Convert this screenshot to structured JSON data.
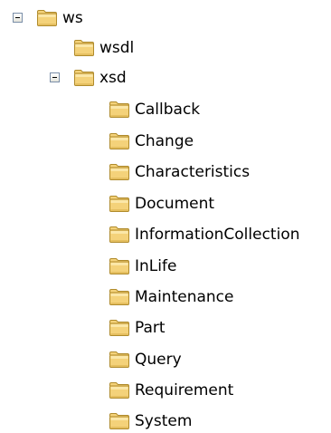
{
  "tree": {
    "root": {
      "label": "ws",
      "expanded": true,
      "children": [
        {
          "label": "wsdl"
        },
        {
          "label": "xsd",
          "expanded": true,
          "children": [
            {
              "label": "Callback"
            },
            {
              "label": "Change"
            },
            {
              "label": "Characteristics"
            },
            {
              "label": "Document"
            },
            {
              "label": "InformationCollection"
            },
            {
              "label": "InLife"
            },
            {
              "label": "Maintenance"
            },
            {
              "label": "Part"
            },
            {
              "label": "Query"
            },
            {
              "label": "Requirement"
            },
            {
              "label": "System"
            }
          ]
        }
      ]
    }
  },
  "icons": {
    "folder": "folder-icon",
    "collapse": "minus-box-icon"
  },
  "colors": {
    "folder_fill": "#f4d27a",
    "folder_edge": "#b08b2c",
    "expander_border": "#7a8ea8"
  }
}
